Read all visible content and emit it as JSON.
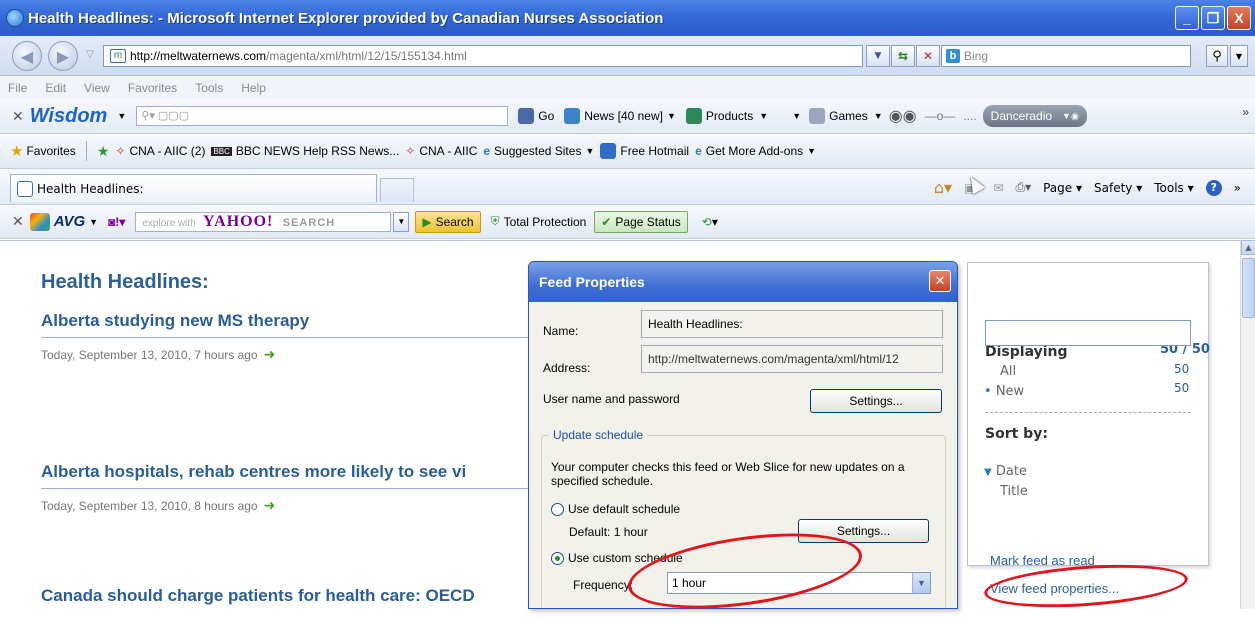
{
  "window": {
    "title": "Health Headlines: - Microsoft Internet Explorer provided by Canadian Nurses Association",
    "minimize": "_",
    "maximize": "❐",
    "close": "X"
  },
  "address_bar": {
    "url_host": "http://meltwaternews.com",
    "url_path": "/magenta/xml/html/12/15/155134.html",
    "search_placeholder": "Bing"
  },
  "menu": [
    "File",
    "Edit",
    "View",
    "Favorites",
    "Tools",
    "Help"
  ],
  "wisdom_toolbar": {
    "logo": "Wisdom",
    "search_text": "▢▢▢",
    "go": "Go",
    "news": "News [40 new]",
    "products": "Products",
    "games": "Games",
    "player_text": "....",
    "radio": "Danceradio"
  },
  "favorites_bar": {
    "favorites": "Favorites",
    "links": [
      "CNA - AIIC (2)",
      "BBC NEWS Help RSS News...",
      "CNA - AIIC",
      "Suggested Sites",
      "Free Hotmail",
      "Get More Add-ons"
    ],
    "bbc_badge": "BBC"
  },
  "tab": {
    "label": "Health Headlines:"
  },
  "command_bar": {
    "page": "Page",
    "safety": "Safety",
    "tools": "Tools"
  },
  "avg_toolbar": {
    "logo": "AVG",
    "yahoo_placeholder": "explore with",
    "yahoo_logo": "YAHOO!",
    "yahoo_search": "SEARCH",
    "search_btn": "Search",
    "total_protection": "Total Protection",
    "page_status": "Page Status"
  },
  "feed": {
    "title": "Health Headlines:",
    "articles": [
      {
        "headline": "Alberta studying new MS therapy",
        "date": "Today, September 13, 2010, 7 hours ago"
      },
      {
        "headline": "Alberta hospitals, rehab centres more likely to see vi",
        "date": "Today, September 13, 2010, 8 hours ago"
      },
      {
        "headline": "Canada should charge patients for health care: OECD",
        "date": ""
      }
    ]
  },
  "dialog": {
    "title": "Feed Properties",
    "name_label": "Name:",
    "name_value": "Health Headlines:",
    "address_label": "Address:",
    "address_value": "http://meltwaternews.com/magenta/xml/html/12",
    "userpass_label": "User name and password",
    "settings_btn": "Settings...",
    "group_title": "Update schedule",
    "group_desc": "Your computer checks this feed or Web Slice for new updates on a specified schedule.",
    "default_schedule": "Use default schedule",
    "default_value": "Default: 1 hour",
    "custom_schedule": "Use custom schedule",
    "frequency_label": "Frequency:",
    "frequency_value": "1 hour"
  },
  "side_panel": {
    "displaying": "Displaying",
    "count": "50 / 50",
    "all_label": "All",
    "all_count": "50",
    "new_label": "New",
    "new_count": "50",
    "sort_by": "Sort by:",
    "sort_date": "Date",
    "sort_title": "Title",
    "mark_read": "Mark feed as read",
    "view_props": "View feed properties..."
  },
  "colors": {
    "accent": "#2b5f9e",
    "annotation": "#e3141b",
    "titlebar": "#3369d8"
  }
}
